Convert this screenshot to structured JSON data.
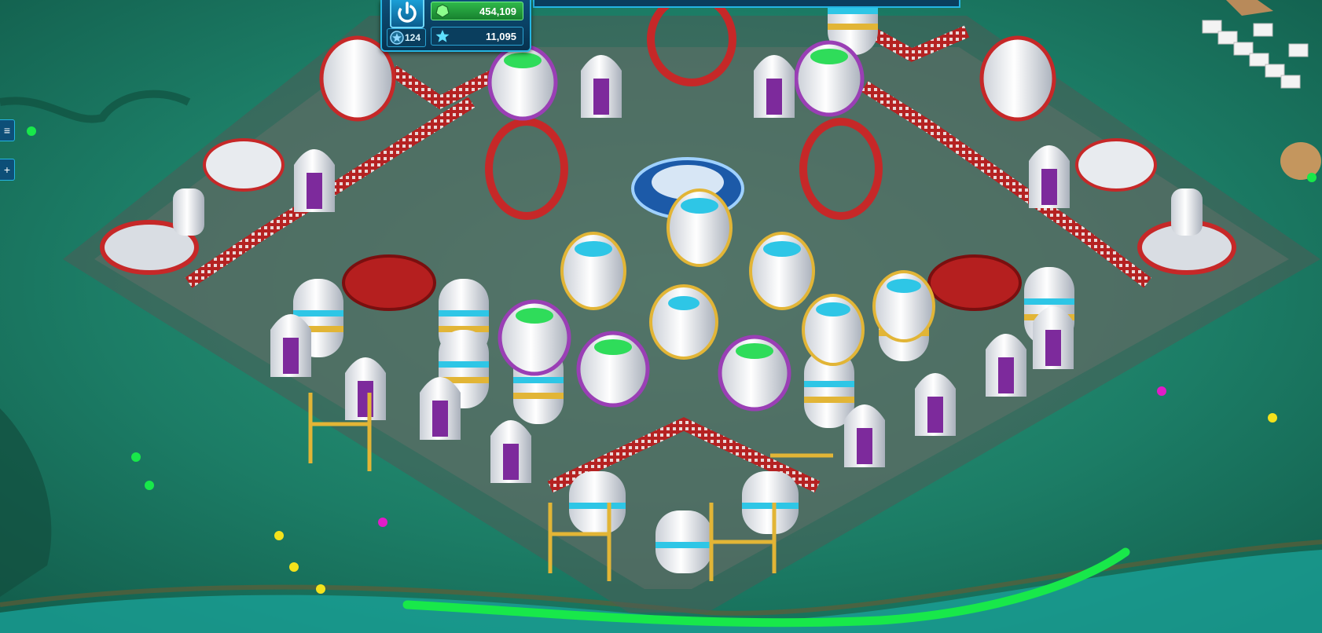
{
  "hud": {
    "crystals": "454,109",
    "level": "124",
    "stars": "11,095"
  },
  "side": {
    "menu_glyph": "≡",
    "add_glyph": "+"
  },
  "colors": {
    "grass": "#1f8a72",
    "hud_blue": "#0d4f78",
    "hud_border": "#24b5e3",
    "crystal_green": "#2fb84a",
    "wall_red": "#c62828",
    "building_white": "#ebeef2",
    "accent_purple": "#9a3fb5",
    "accent_cyan": "#2ec6e6",
    "accent_gold": "#e2b536",
    "marker_green": "#18e84a",
    "marker_yellow": "#f4e21c",
    "marker_magenta": "#e21cc8"
  },
  "icons": [
    "power-icon",
    "crystal-icon",
    "level-star-icon",
    "star-icon",
    "menu-icon",
    "add-icon"
  ]
}
